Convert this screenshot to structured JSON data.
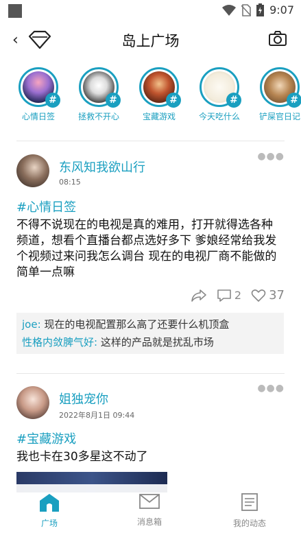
{
  "status_bar": {
    "time": "9:07"
  },
  "header": {
    "title": "岛上广场"
  },
  "topics": [
    {
      "label": "心情日签"
    },
    {
      "label": "拯救不开心"
    },
    {
      "label": "宝藏游戏"
    },
    {
      "label": "今天吃什么"
    },
    {
      "label": "铲屎官日记"
    }
  ],
  "posts": [
    {
      "username": "东风知我欲山行",
      "time": "08:15",
      "tag": "#心情日签",
      "content": "不得不说现在的电视是真的难用，打开就得选各种频道，想看个直播台都点选好多下 爹娘经常给我发个视频过来问我怎么调台 现在的电视厂商不能做的简单一点嘛",
      "comment_count": "2",
      "like_count": "37",
      "comments": [
        {
          "name": "joe:",
          "text": " 现在的电视配置那么高了还要什么机顶盒"
        },
        {
          "name": "性格内敛脾气好:",
          "text": " 这样的产品就是扰乱市场"
        }
      ]
    },
    {
      "username": "姐独宠你",
      "time": "2022年8月1日 09:44",
      "tag": "#宝藏游戏",
      "content": "我也卡在30多星这不动了"
    }
  ],
  "tabbar": {
    "items": [
      {
        "label": "广场"
      },
      {
        "label": "消息箱"
      },
      {
        "label": "我的动态"
      }
    ]
  },
  "colors": {
    "accent": "#1a9fc0"
  }
}
